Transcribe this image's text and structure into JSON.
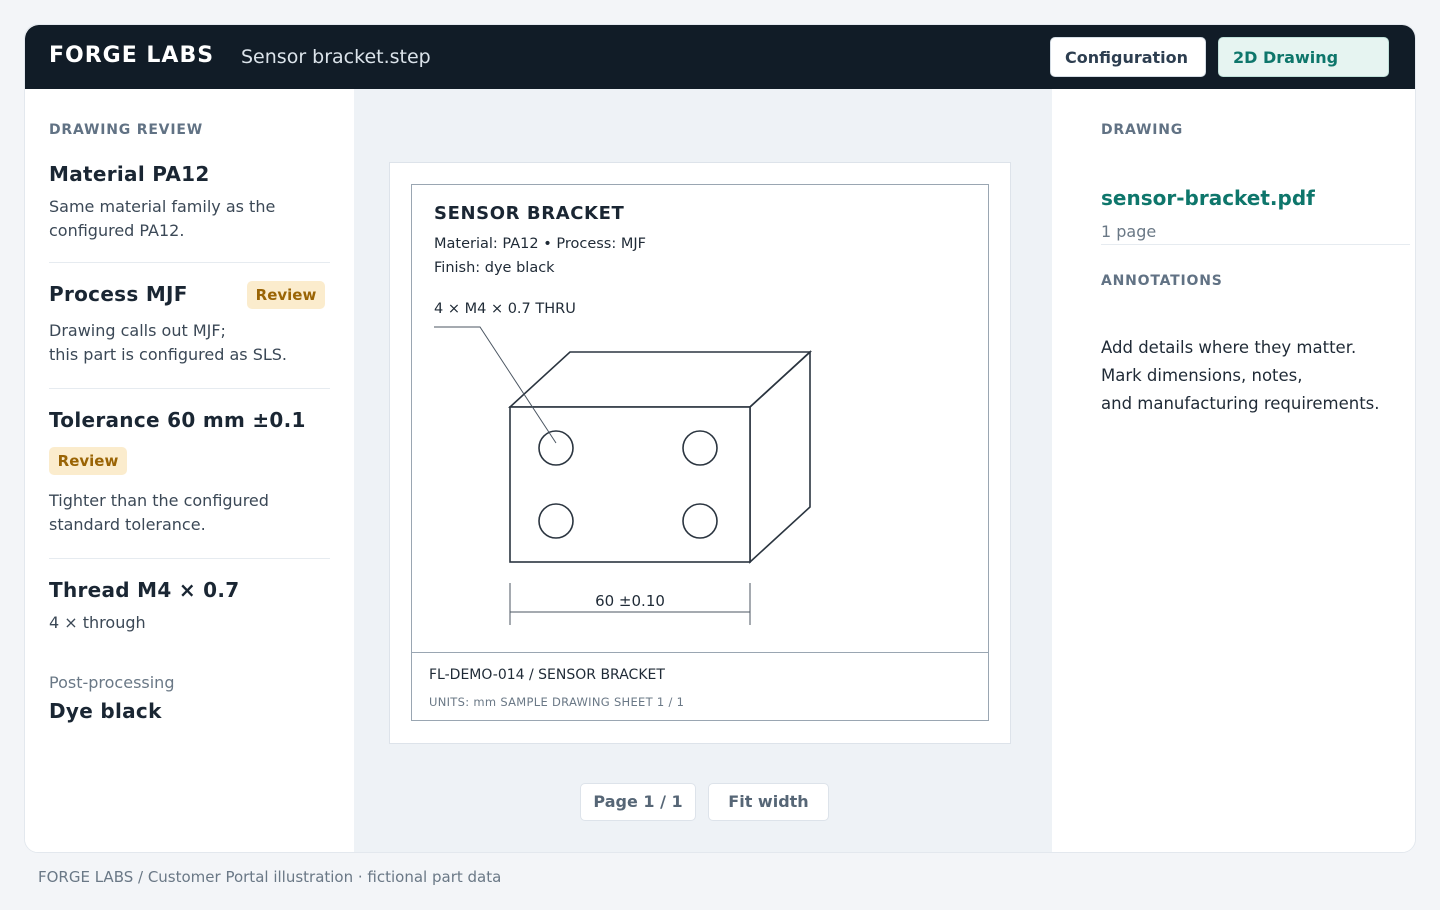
{
  "header": {
    "brand": "FORGE LABS",
    "filename": "Sensor bracket.step",
    "tabs": [
      {
        "label": "Configuration",
        "active": false
      },
      {
        "label": "2D Drawing",
        "active": true
      }
    ]
  },
  "review": {
    "section_label": "DRAWING REVIEW",
    "items": [
      {
        "title": "Material PA12",
        "lines": [
          "Same material family as the",
          "configured PA12."
        ],
        "badge": ""
      },
      {
        "title": "Process MJF",
        "lines": [
          "Drawing calls out MJF;",
          "this part is configured as SLS."
        ],
        "badge": "Review"
      },
      {
        "title": "Tolerance 60 mm ±0.1",
        "lines": [
          "Tighter than the configured",
          "standard tolerance."
        ],
        "badge": "Review"
      },
      {
        "title": "Thread M4 × 0.7",
        "lines": [
          "4 × through"
        ],
        "badge": ""
      }
    ],
    "post_label": "Post-processing",
    "post_value": "Dye black"
  },
  "drawing": {
    "title": "SENSOR BRACKET",
    "line1": "Material: PA12 • Process: MJF",
    "line2": "Finish: dye black",
    "thread_note": "4 × M4 × 0.7 THRU",
    "dimension": "60 ±0.10",
    "titleblock_main": "FL-DEMO-014 / SENSOR BRACKET",
    "titleblock_sub": "UNITS: mm SAMPLE DRAWING SHEET 1 / 1"
  },
  "pager": {
    "page": "Page 1 / 1",
    "fit": "Fit width"
  },
  "file_panel": {
    "section_label": "DRAWING",
    "filename": "sensor-bracket.pdf",
    "pages": "1 page",
    "annotations_label": "ANNOTATIONS",
    "annotations_lines": [
      "Add details where they matter.",
      "Mark dimensions, notes,",
      "and manufacturing requirements."
    ]
  },
  "footer": "FORGE LABS / Customer Portal illustration · fictional part data",
  "colors": {
    "header_bg": "#111c27",
    "accent": "#0e766b",
    "badge_bg": "#fbeccd",
    "badge_text": "#9a6405"
  }
}
